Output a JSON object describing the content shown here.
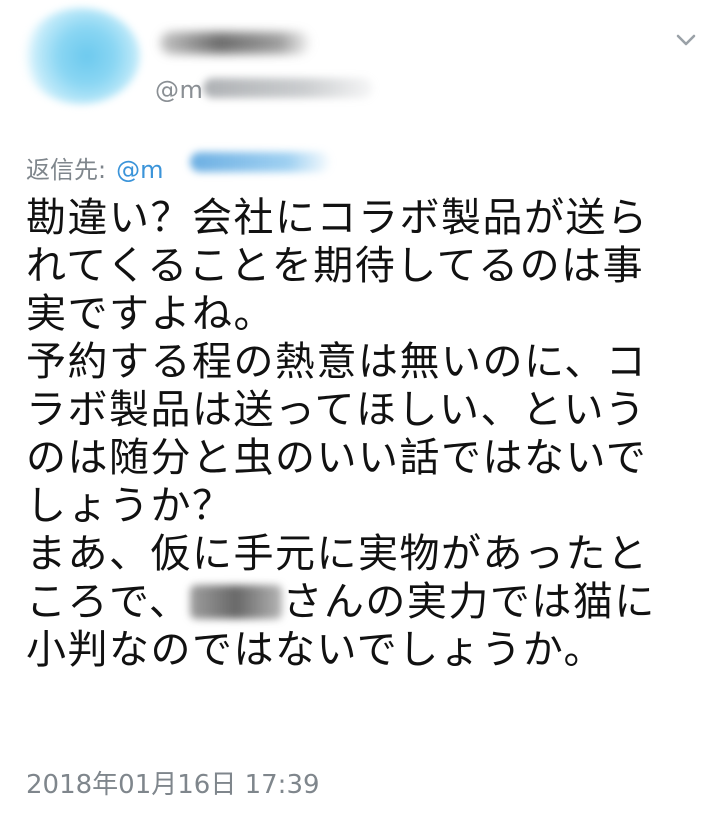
{
  "tweet": {
    "handle_prefix": "@m",
    "reply_label": "返信先:",
    "reply_handle_prefix": "@m",
    "body_lines": [
      "勘違い？会社にコラボ製品が送ら",
      "れてくることを期待してるのは事",
      "実ですよね。",
      "予約する程の熱意は無いのに、コ",
      "ラボ製品は送ってほしい、という",
      "のは随分と虫のいい話ではないで",
      "しょうか？",
      "まあ、仮に手元に実物があったと"
    ],
    "line9_before": "ころで、",
    "line9_after": "さんの実力では猫に",
    "line10": "小判なのではないでしょうか。",
    "timestamp": "2018年01月16日 17:39"
  },
  "icons": {
    "menu": "chevron-down-icon"
  },
  "colors": {
    "link": "#3b94d9",
    "meta_gray": "#7f868c",
    "text": "#111111"
  }
}
